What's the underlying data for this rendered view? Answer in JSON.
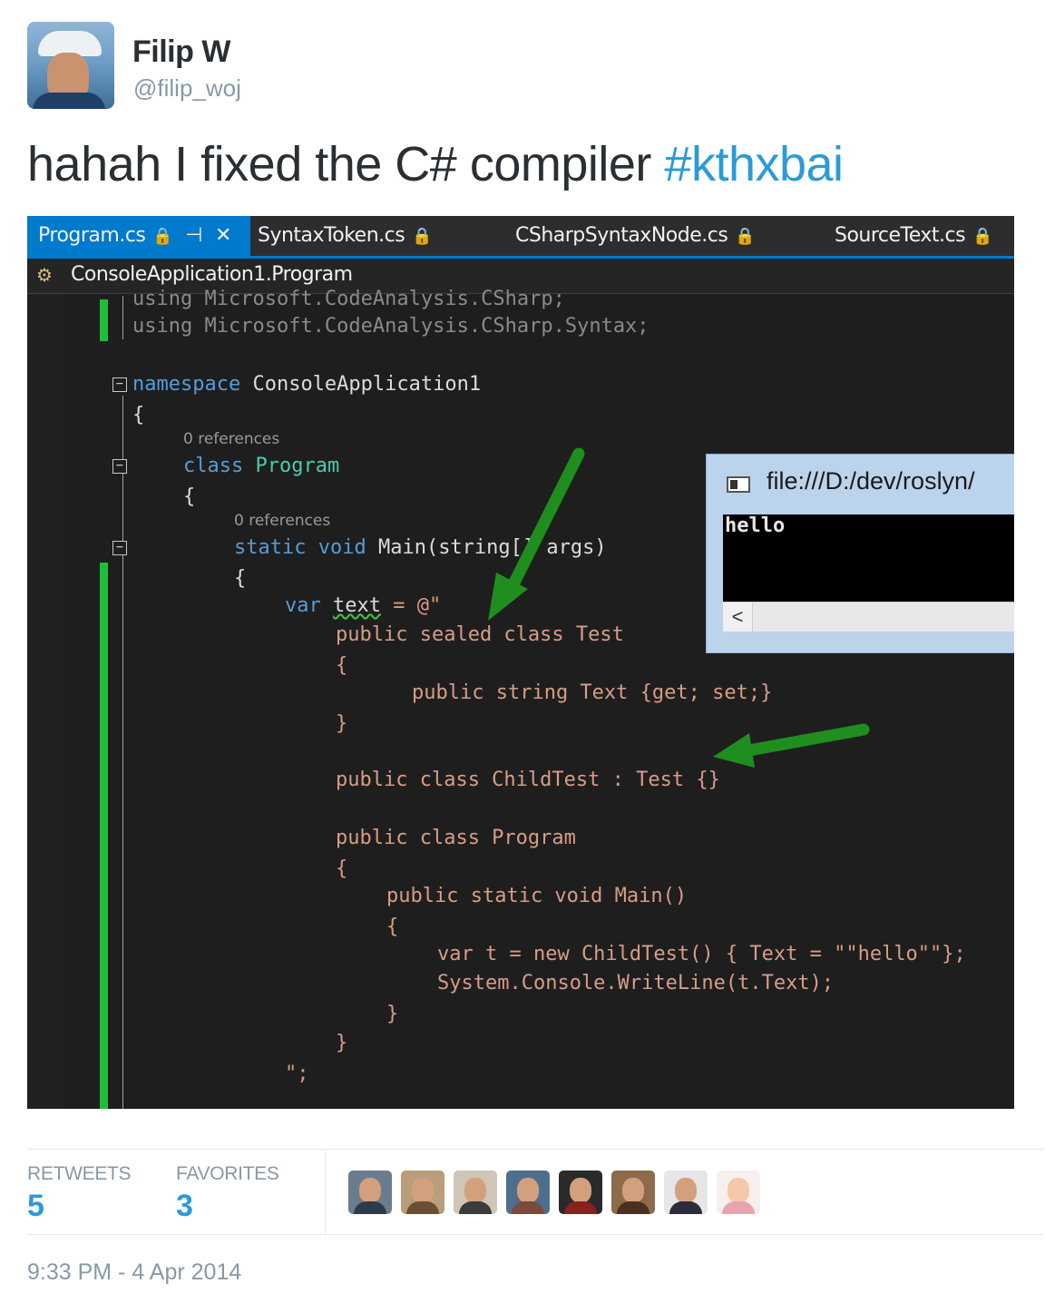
{
  "tweet": {
    "name": "Filip W",
    "handle": "@filip_woj",
    "text": "hahah I fixed the C# compiler ",
    "hashtag": "#kthxbai",
    "retweets_label": "RETWEETS",
    "retweets": "5",
    "favorites_label": "FAVORITES",
    "favorites": "3",
    "timestamp": "9:33 PM - 4 Apr 2014"
  },
  "editor": {
    "tabs": [
      {
        "label": "Program.cs"
      },
      {
        "label": "SyntaxToken.cs"
      },
      {
        "label": "CSharpSyntaxNode.cs"
      },
      {
        "label": "SourceText.cs"
      }
    ],
    "tab_lock_icon": "🔒",
    "tab_pin_icon": "⊣",
    "tab_close_icon": "✕",
    "navbar_label": "ConsoleApplication1.Program",
    "codelens": [
      "0 references",
      "0 references"
    ],
    "code": {
      "using1": "using Microsoft.CodeAnalysis.CSharp;",
      "using2_kw": "using",
      "using2_rest": " Microsoft.CodeAnalysis.CSharp.Syntax;",
      "ns_kw": "namespace",
      "ns_name": " ConsoleApplication1",
      "open_brace": "{",
      "close_brace": "}",
      "class_kw": "class",
      "class_name": " Program",
      "static_kw": "static",
      "void_kw": "void",
      "main_rest": " Main(string[] args)",
      "var_kw": "var",
      "var_name": "text",
      "var_assign": " = @\"",
      "l1": "public sealed class Test",
      "l2": "public string Text {get; set;}",
      "l3": "public class ChildTest : Test {}",
      "l4": "public class Program",
      "l5": "public static void Main()",
      "l6": "var t = new ChildTest() { Text = \"\"hello\"\"};",
      "l7": "System.Console.WriteLine(t.Text);",
      "end": "\";"
    }
  },
  "console": {
    "title": "file:///D:/dev/roslyn/",
    "output": "hello",
    "scroll_left": "<"
  },
  "colors": {
    "link": "#2b9bd7",
    "vs_accent": "#007acc",
    "change_bar": "#1fbd3a",
    "arrow": "#1e8f1e"
  }
}
